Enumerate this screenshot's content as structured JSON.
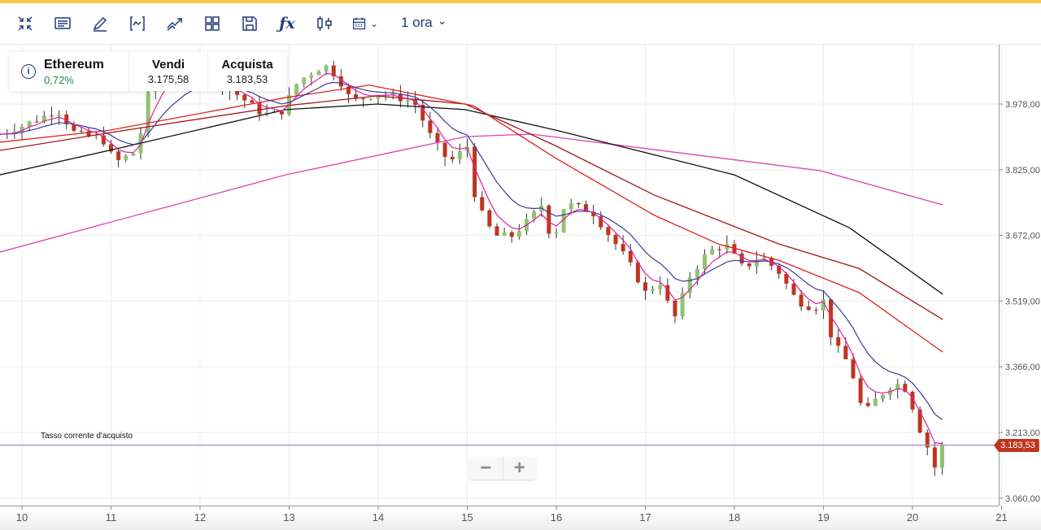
{
  "toolbar": {
    "icons": [
      "collapse-icon",
      "news-icon",
      "draw-icon",
      "indicator-icon",
      "trend-icon",
      "layout-icon",
      "save-icon",
      "formula-icon",
      "candlestick-icon",
      "calendar-icon"
    ],
    "interval": "1 ora"
  },
  "instrument": {
    "name": "Ethereum",
    "change": "0,72%",
    "sell_label": "Vendi",
    "sell": "3.175,58",
    "buy_label": "Acquista",
    "buy": "3.183,53"
  },
  "current_rate_label": "Tasso corrente d'acquisto",
  "current_price_tag": "3.183,53",
  "zoom": {
    "minus": "−",
    "plus": "+"
  },
  "colors": {
    "up": "#8fc46f",
    "down": "#c0341d",
    "accent": "#1f3a7a",
    "change_positive": "#1a8a4a",
    "current_line": "#a89bc8"
  },
  "chart_data": {
    "type": "candlestick",
    "x_ticks": [
      "10",
      "11",
      "12",
      "13",
      "14",
      "15",
      "16",
      "17",
      "18",
      "19",
      "20",
      "21"
    ],
    "y_ticks": [
      "3.978,00",
      "3.825,00",
      "3.672,00",
      "3.519,00",
      "3.366,00",
      "3.213,00",
      "3.060,00"
    ],
    "y_tick_values": [
      3978,
      3825,
      3672,
      3519,
      3366,
      3213,
      3060
    ],
    "x_range": [
      9.75,
      21.05
    ],
    "current_price": 3183.53,
    "price_path": [
      [
        9.75,
        3908
      ],
      [
        10.0,
        3927
      ],
      [
        10.2,
        3945
      ],
      [
        10.4,
        3965
      ],
      [
        10.6,
        3908
      ],
      [
        10.9,
        3898
      ],
      [
        11.05,
        3842
      ],
      [
        11.3,
        3870
      ],
      [
        11.4,
        3993
      ],
      [
        11.6,
        4060
      ],
      [
        12.0,
        4050
      ],
      [
        12.4,
        4003
      ],
      [
        12.7,
        3955
      ],
      [
        12.9,
        3955
      ],
      [
        13.1,
        4031
      ],
      [
        13.4,
        4069
      ],
      [
        13.55,
        4040
      ],
      [
        13.7,
        3984
      ],
      [
        14.0,
        4003
      ],
      [
        14.4,
        3984
      ],
      [
        14.6,
        3898
      ],
      [
        14.8,
        3842
      ],
      [
        15.0,
        3880
      ],
      [
        15.1,
        3747
      ],
      [
        15.3,
        3671
      ],
      [
        15.5,
        3671
      ],
      [
        15.7,
        3709
      ],
      [
        15.85,
        3747
      ],
      [
        15.95,
        3652
      ],
      [
        16.1,
        3747
      ],
      [
        16.4,
        3728
      ],
      [
        16.6,
        3671
      ],
      [
        16.8,
        3614
      ],
      [
        17.0,
        3539
      ],
      [
        17.2,
        3567
      ],
      [
        17.3,
        3463
      ],
      [
        17.5,
        3577
      ],
      [
        17.7,
        3633
      ],
      [
        17.9,
        3652
      ],
      [
        18.1,
        3595
      ],
      [
        18.3,
        3624
      ],
      [
        18.5,
        3586
      ],
      [
        18.7,
        3520
      ],
      [
        18.9,
        3501
      ],
      [
        19.0,
        3520
      ],
      [
        19.1,
        3425
      ],
      [
        19.3,
        3368
      ],
      [
        19.45,
        3254
      ],
      [
        19.6,
        3292
      ],
      [
        19.8,
        3330
      ],
      [
        19.95,
        3311
      ],
      [
        20.05,
        3235
      ],
      [
        20.15,
        3189
      ],
      [
        20.25,
        3132
      ],
      [
        20.34,
        3183.53
      ]
    ],
    "moving_averages": [
      {
        "color": "#e040b0",
        "points": [
          [
            9.75,
            3633
          ],
          [
            12.96,
            3813
          ],
          [
            14.98,
            3902
          ],
          [
            15.72,
            3908
          ],
          [
            18.96,
            3823
          ],
          [
            20.34,
            3743
          ]
        ]
      },
      {
        "color": "#111111",
        "points": [
          [
            9.75,
            3813
          ],
          [
            10.98,
            3870
          ],
          [
            12.96,
            3965
          ],
          [
            13.99,
            3978
          ],
          [
            14.98,
            3965
          ],
          [
            16.0,
            3917
          ],
          [
            18.0,
            3813
          ],
          [
            19.29,
            3690
          ],
          [
            20.34,
            3535
          ]
        ]
      },
      {
        "color": "#a01818",
        "points": [
          [
            9.75,
            3870
          ],
          [
            11.16,
            3917
          ],
          [
            12.96,
            3974
          ],
          [
            13.99,
            3997
          ],
          [
            14.98,
            3978
          ],
          [
            16.0,
            3880
          ],
          [
            17.1,
            3766
          ],
          [
            18.5,
            3652
          ],
          [
            19.4,
            3595
          ],
          [
            20.34,
            3476
          ]
        ]
      },
      {
        "color": "#e02020",
        "points": [
          [
            9.75,
            3889
          ],
          [
            10.98,
            3917
          ],
          [
            12.96,
            3993
          ],
          [
            13.9,
            4022
          ],
          [
            15.07,
            3974
          ],
          [
            16.0,
            3851
          ],
          [
            17.1,
            3719
          ],
          [
            17.82,
            3652
          ],
          [
            18.5,
            3614
          ],
          [
            19.4,
            3539
          ],
          [
            20.34,
            3400
          ]
        ]
      }
    ],
    "fast_averages": [
      {
        "color": "#3a3a9a",
        "period": 10
      },
      {
        "color": "#e0209a",
        "period": 4
      }
    ]
  }
}
